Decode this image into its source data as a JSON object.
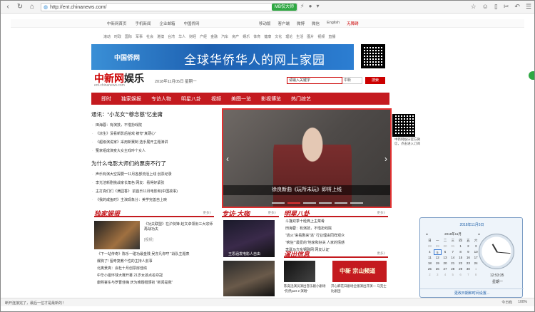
{
  "browser": {
    "url": "http://ent.chinanews.com/",
    "badge": "MB仅大师",
    "icons": [
      "back-icon",
      "home-icon",
      "star-icon"
    ]
  },
  "site_topbar": {
    "links": [
      "中新网首页",
      "手机新闻",
      "企业邮箱",
      "中国侨网"
    ],
    "right_links": [
      "移动版",
      "客户端",
      "微博",
      "微信",
      "English",
      "无障碍"
    ]
  },
  "channels": [
    "滚动",
    "时政",
    "国际",
    "军事",
    "社会",
    "港澳",
    "台湾",
    "华人",
    "财经",
    "产经",
    "金融",
    "汽车",
    "房产",
    "娱乐",
    "体育",
    "健康",
    "文化",
    "理论",
    "生活",
    "图片",
    "视频",
    "直播"
  ],
  "banner": {
    "left_logo": "中国侨网",
    "slogan": "全球华侨华人的网上家园"
  },
  "header": {
    "logo": "中新网",
    "logo_ent": "娱乐",
    "sub": "ent.chinanews.com",
    "date": "2018年11月05日  星期一",
    "search_placeholder": "请输入关键字",
    "search_scope": "中新",
    "search_button": "搜索"
  },
  "nav": [
    "即时",
    "独家娱报",
    "专访人物",
    "明星八卦",
    "视频",
    "美图一览",
    "影视博览",
    "热门综艺"
  ],
  "news": {
    "headline1": "通讯：“小龙女”“穆念慈”忆金庸",
    "items1": [
      "田海蓉：有演技，不惜扮戏院",
      "《凉生》没看新影后拍戏 被夸“真硬心”",
      "《超级演说家》采用新赛制 选手展开主题演讲",
      "冤家组成演变大女主戏吟个女人"
    ],
    "headline2": "为什么电影大师们的票房不行了",
    "items2": [
      "声乐有演大空探要一11月各部流活上线 创票纪录",
      "李光洁新剧挑战家长角色 网友：看得好紧张",
      "主打真们们《满园香》 前首乐11月电影和(中国故事)",
      "《我的咸鱼时》主演现象分：美学完善自上映"
    ]
  },
  "slider": {
    "caption": "徐良新曲《玩所未玩》即将上线",
    "qr_caption": "中新网娱乐官方微信，点击进入订阅"
  },
  "sections": {
    "exclusive": {
      "title": "独家娱报",
      "more": "更多》",
      "lead": "《功夫联盟》在沪剑锋 赵文卓领衔三大宗师再战功夫",
      "tag": "[视频]",
      "items": [
        "《下一站传奇》陈乐一碰功最金贱 吴亦凡你哼 “战队主题表",
        "爆狗了! 留奇复教个性的主持人剪事",
        "北奥景爽：会杜十月创票房佳绩",
        "中华小姐环球大赛开幕 21岁女孩点名夺冠",
        "康熙宴东与罗晋佳嗨 厌为难题帽颁初 “新闻是我”"
      ]
    },
    "interview": {
      "title": "专访·大咖",
      "more": "更多》",
      "photo1_caption": "王思涵发电影人自由",
      "photo2_caption": "潘粤明"
    },
    "gossip": {
      "title": "明星八卦",
      "more": "更多》",
      "items": [
        "斗篷双季十经典上主菜肴",
        "田海蓉：有演技，不惜扮戏院",
        "“逃火”来看剧来“逃” 行业理由同样观众",
        "“疯狂”“最爱的“地家和好关 人家的情感",
        "李诞马方东钢融网 网友认证'"
      ]
    },
    "show": {
      "title": "演出信息",
      "more": "更多》",
      "caption1": "陈奕迅演员演出音乐剧小剧场 “仍然part 2 演唱”",
      "caption2": "开心麻花日剧场全版演出开演一 马克士比剧团",
      "poster_text": "中新 宗山频道"
    }
  },
  "calendar": {
    "month_title": "2018年11月5日",
    "nav": "2018年11月",
    "weekdays": [
      "日",
      "一",
      "二",
      "三",
      "四",
      "五",
      "六"
    ],
    "rows": [
      [
        "28",
        "29",
        "30",
        "31",
        "1",
        "2",
        "3"
      ],
      [
        "4",
        "5",
        "6",
        "7",
        "8",
        "9",
        "10"
      ],
      [
        "11",
        "12",
        "13",
        "14",
        "15",
        "16",
        "17"
      ],
      [
        "18",
        "19",
        "20",
        "21",
        "22",
        "23",
        "24"
      ],
      [
        "25",
        "26",
        "27",
        "28",
        "29",
        "30",
        "1"
      ],
      [
        "2",
        "3",
        "4",
        "5",
        "6",
        "7",
        "8"
      ]
    ],
    "time": "12:53:35",
    "weekday": "星期一",
    "footer": "更改日期和时间设置..."
  },
  "status_bar": {
    "left": "断开连接完了，最后一位才是最新的！",
    "right": [
      "今日有",
      "100%"
    ]
  }
}
